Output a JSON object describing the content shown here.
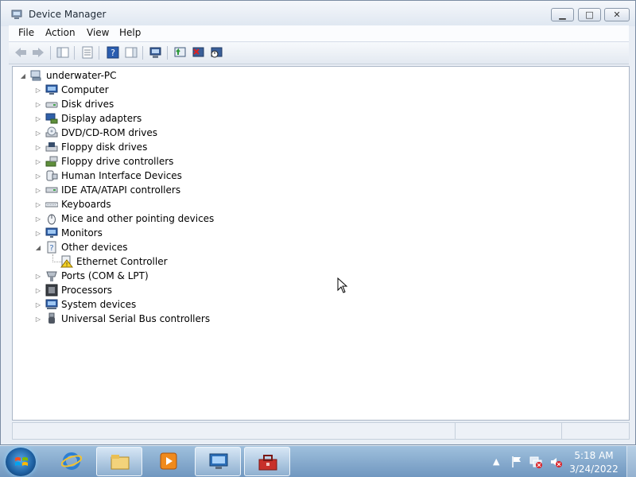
{
  "window": {
    "title": "Device Manager",
    "minimize_icon": "minimize-icon",
    "maximize_icon": "restore-icon",
    "close_icon": "close-icon"
  },
  "menu": {
    "items": [
      "File",
      "Action",
      "View",
      "Help"
    ]
  },
  "toolbar": {
    "buttons": [
      "back-icon",
      "forward-icon",
      "show-hide-console-tree-icon",
      "properties-icon",
      "help-icon",
      "show-hide-action-pane-icon",
      "scan-hardware-icon",
      "update-driver-icon",
      "uninstall-icon",
      "disable-icon"
    ]
  },
  "tree": {
    "root": "underwater-PC",
    "categories": [
      {
        "label": "Computer",
        "icon": "computer-icon",
        "expanded": false
      },
      {
        "label": "Disk drives",
        "icon": "disk-drive-icon",
        "expanded": false
      },
      {
        "label": "Display adapters",
        "icon": "display-adapter-icon",
        "expanded": false
      },
      {
        "label": "DVD/CD-ROM drives",
        "icon": "dvd-drive-icon",
        "expanded": false
      },
      {
        "label": "Floppy disk drives",
        "icon": "floppy-disk-icon",
        "expanded": false
      },
      {
        "label": "Floppy drive controllers",
        "icon": "floppy-controller-icon",
        "expanded": false
      },
      {
        "label": "Human Interface Devices",
        "icon": "hid-icon",
        "expanded": false
      },
      {
        "label": "IDE ATA/ATAPI controllers",
        "icon": "ide-controller-icon",
        "expanded": false
      },
      {
        "label": "Keyboards",
        "icon": "keyboard-icon",
        "expanded": false
      },
      {
        "label": "Mice and other pointing devices",
        "icon": "mouse-icon",
        "expanded": false
      },
      {
        "label": "Monitors",
        "icon": "monitor-icon",
        "expanded": false
      },
      {
        "label": "Other devices",
        "icon": "other-devices-icon",
        "expanded": true
      },
      {
        "label": "Ethernet Controller",
        "icon": "warning-device-icon",
        "child": true
      },
      {
        "label": "Ports (COM & LPT)",
        "icon": "port-icon",
        "expanded": false
      },
      {
        "label": "Processors",
        "icon": "processor-icon",
        "expanded": false
      },
      {
        "label": "System devices",
        "icon": "system-devices-icon",
        "expanded": false
      },
      {
        "label": "Universal Serial Bus controllers",
        "icon": "usb-icon",
        "expanded": false
      }
    ]
  },
  "taskbar": {
    "start_icon": "windows-start-icon",
    "pinned": [
      "internet-explorer-icon",
      "windows-explorer-icon",
      "media-player-icon",
      "remote-desktop-icon",
      "device-manager-taskbar-icon"
    ],
    "tray_icons": [
      "show-hidden-icons-arrow",
      "action-center-flag-icon",
      "network-icon",
      "volume-muted-icon"
    ],
    "time": "5:18 AM",
    "date": "3/24/2022"
  }
}
